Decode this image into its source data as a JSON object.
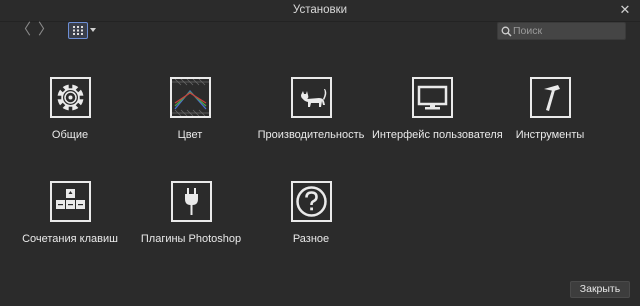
{
  "window": {
    "title": "Установки",
    "close_glyph": "✕"
  },
  "toolbar": {
    "back_glyph": "〈",
    "forward_glyph": "〉",
    "view_mode": "grid-icon",
    "search_placeholder": "Поиск"
  },
  "tiles": [
    {
      "label": "Общие",
      "icon": "gear-icon"
    },
    {
      "label": "Цвет",
      "icon": "color-icon"
    },
    {
      "label": "Производительность",
      "icon": "cat-icon"
    },
    {
      "label": "Интерфейс пользователя",
      "icon": "monitor-icon"
    },
    {
      "label": "Инструменты",
      "icon": "hammer-icon"
    },
    {
      "label": "Сочетания клавиш",
      "icon": "keyboard-icon"
    },
    {
      "label": "Плагины Photoshop",
      "icon": "plug-icon"
    },
    {
      "label": "Разное",
      "icon": "question-icon"
    }
  ],
  "footer": {
    "close_label": "Закрыть"
  },
  "colors": {
    "background": "#2b2b2b",
    "accent": "#6d8fd6",
    "icon_stroke": "#eaeaea"
  }
}
